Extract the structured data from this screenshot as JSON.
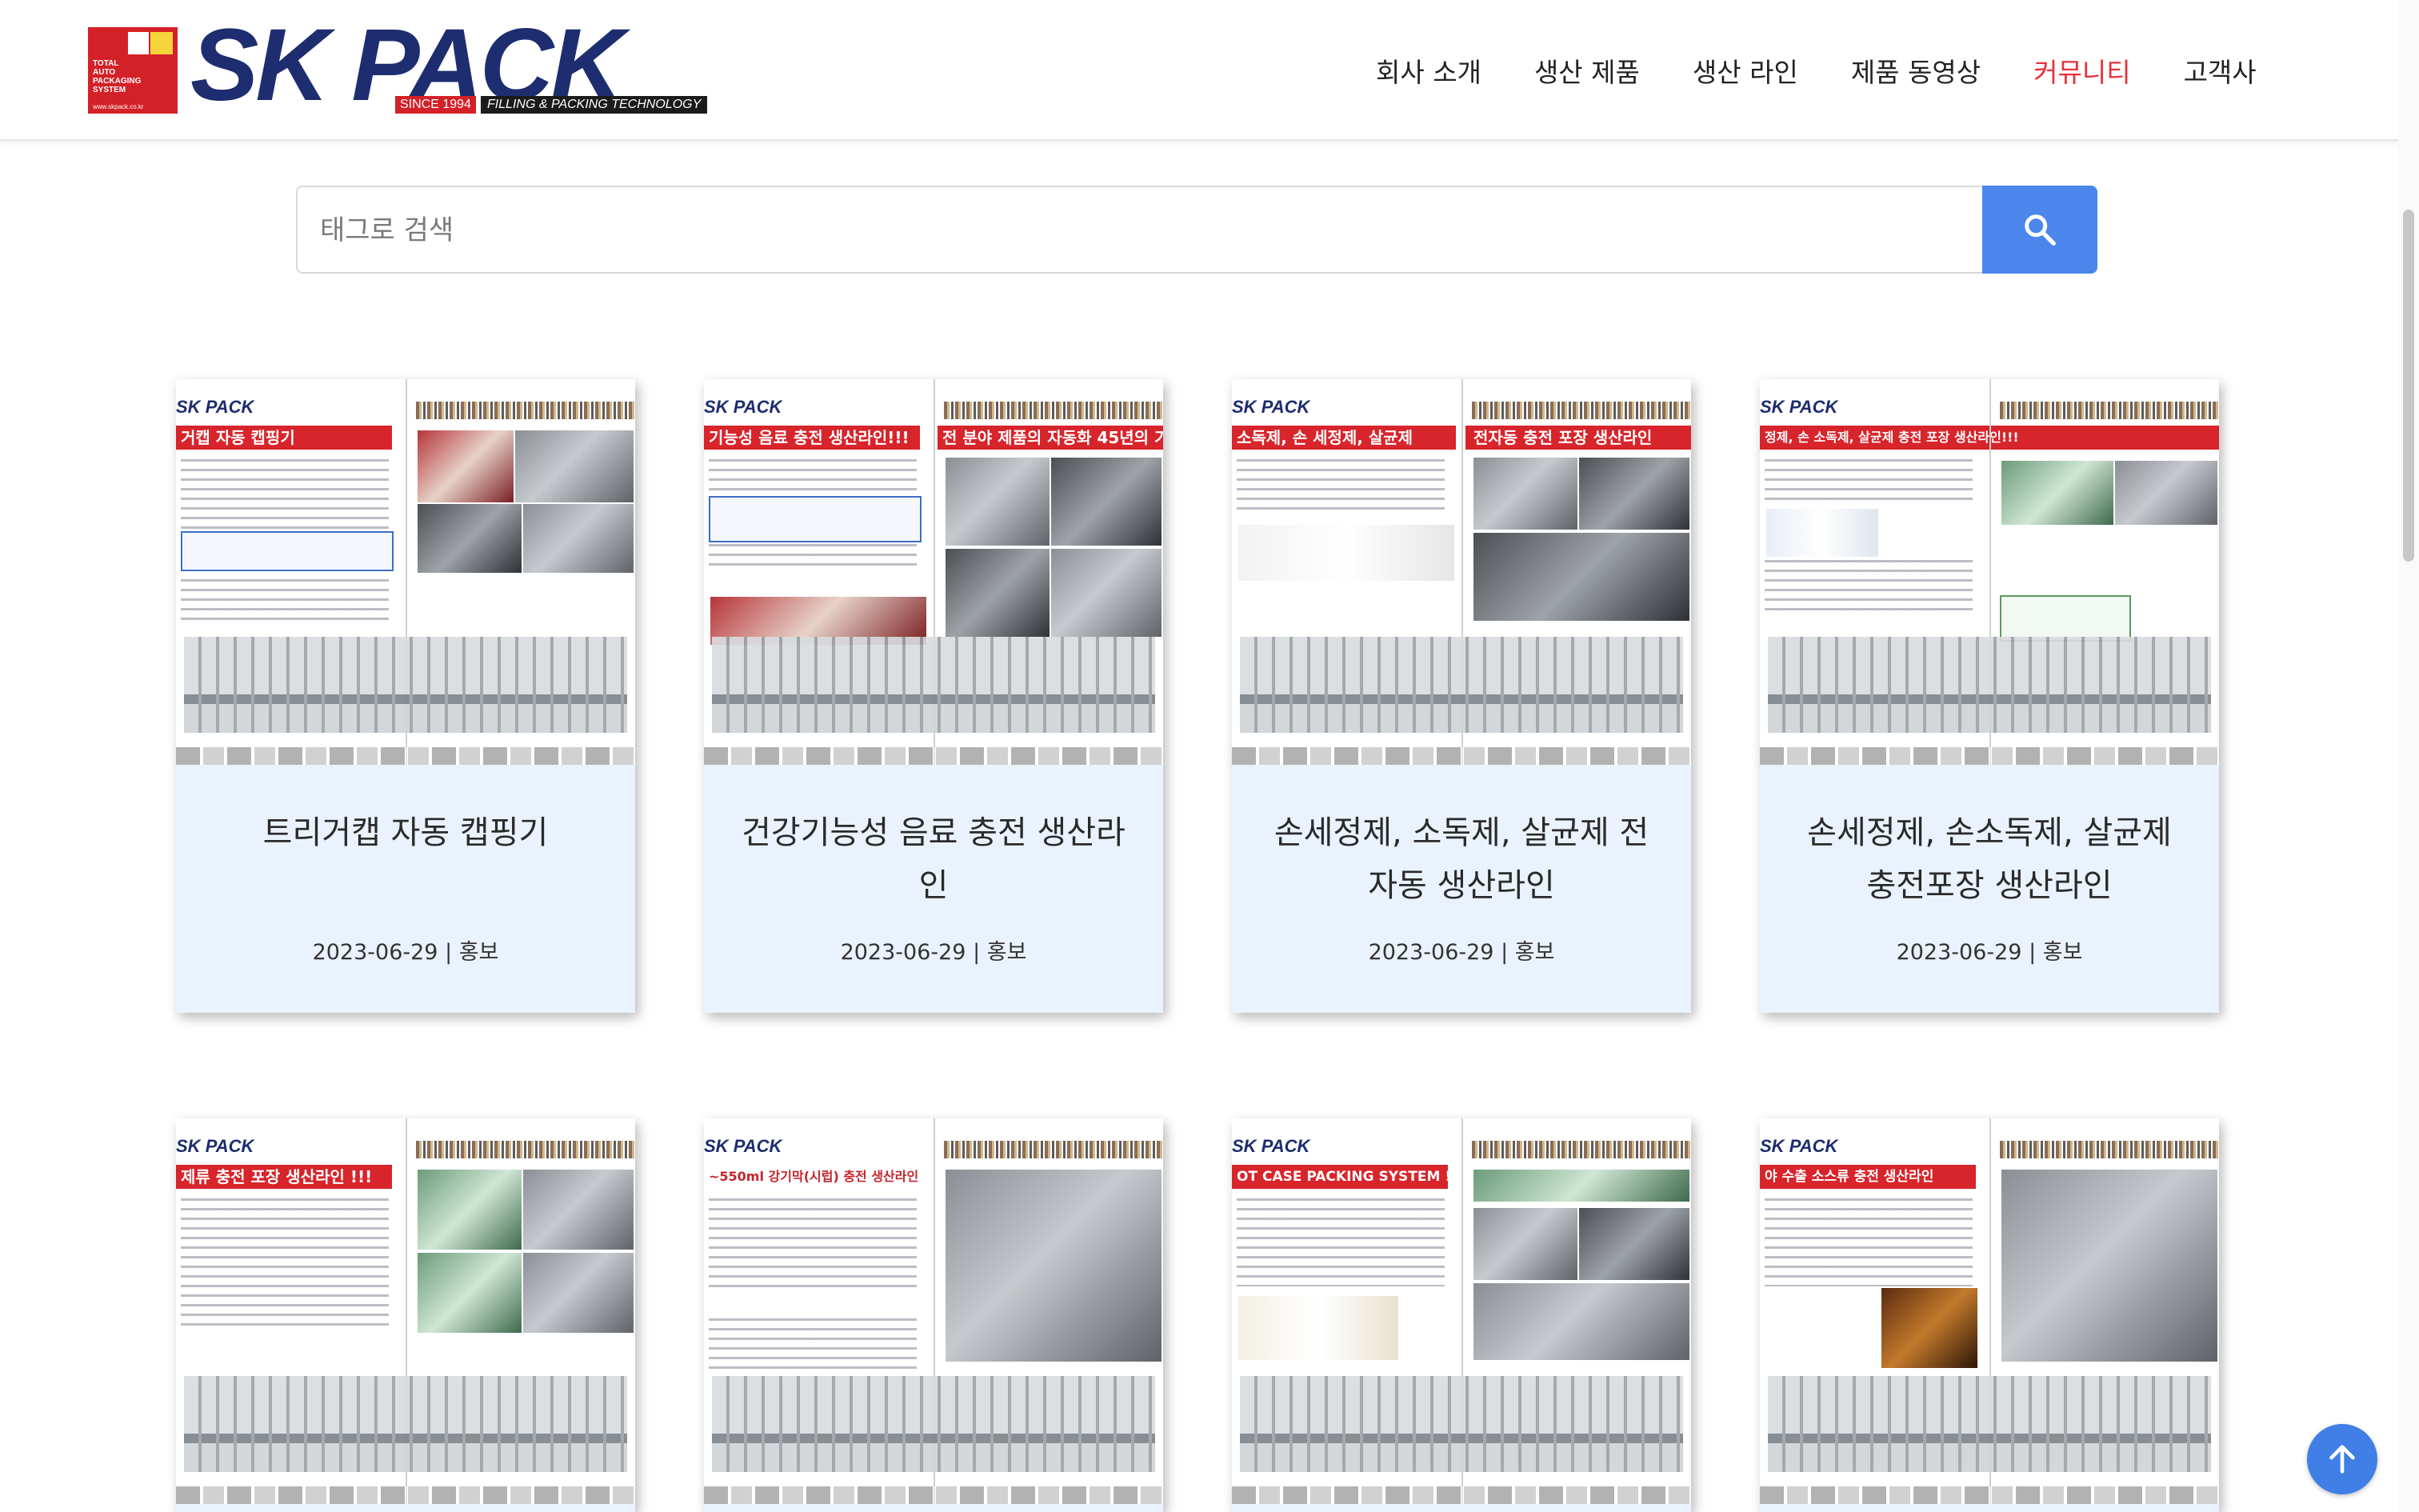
{
  "logo": {
    "box_text": [
      "TOTAL",
      "AUTO",
      "PACKAGING",
      "SYSTEM"
    ],
    "url": "www.skpack.co.kr",
    "word_sk": "SK",
    "word_pack": "PACK",
    "since": "SINCE 1994",
    "tagline": "FILLING & PACKING TECHNOLOGY"
  },
  "nav": {
    "items": [
      "회사 소개",
      "생산 제품",
      "생산 라인",
      "제품 동영상",
      "커뮤니티",
      "고객사"
    ],
    "active": "커뮤니티"
  },
  "search": {
    "placeholder": "태그로 검색",
    "button_icon": "search-icon"
  },
  "cards": [
    {
      "title": "트리거캡 자동 캡핑기",
      "date": "2023-06-29",
      "category": "홍보",
      "thumb_banner": "거캡 자동 캡핑기",
      "thumb_banner2": ""
    },
    {
      "title": "건강기능성 음료 충전 생산라인",
      "date": "2023-06-29",
      "category": "홍보",
      "thumb_banner": "기능성 음료 충전 생산라인!!!",
      "thumb_banner2": "전 분야 제품의 자동화 45년의 기"
    },
    {
      "title": "손세정제, 소독제, 살균제 전자동 생산라인",
      "date": "2023-06-29",
      "category": "홍보",
      "thumb_banner": "소독제, 손 세정제, 살균제",
      "thumb_banner2": "전자동 충전 포장 생산라인"
    },
    {
      "title": "손세정제, 손소독제, 살균제 충전포장 생산라인",
      "date": "2023-06-29",
      "category": "홍보",
      "thumb_banner": "정제, 손 소독제, 살균제 충전 포장 생산라인!!!",
      "thumb_banner2": ""
    },
    {
      "title": "",
      "date": "",
      "category": "",
      "thumb_banner": "제류 충전 포장 생산라인 !!!",
      "thumb_banner2": ""
    },
    {
      "title": "",
      "date": "",
      "category": "",
      "thumb_banner": "~550ml 강기막(시럽) 충전 생산라인",
      "thumb_banner2": ""
    },
    {
      "title": "",
      "date": "",
      "category": "",
      "thumb_banner": "OT CASE PACKING SYSTEM !!!",
      "thumb_banner2": ""
    },
    {
      "title": "",
      "date": "",
      "category": "",
      "thumb_banner": "야 수출 소스류 충전 생산라인",
      "thumb_banner2": ""
    }
  ],
  "colors": {
    "accent": "#e8303a",
    "search_button": "#4a86ec",
    "card_bg": "#eaf3fd",
    "brand_navy": "#1d2d6f",
    "brand_red": "#d42027"
  }
}
